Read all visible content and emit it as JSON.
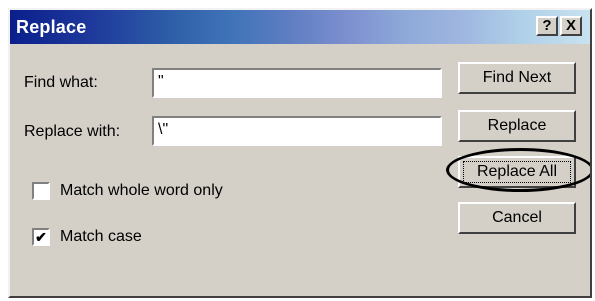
{
  "dialog": {
    "title": "Replace",
    "help_button": "?",
    "close_button": "X",
    "find_what_label": "Find what:",
    "find_what_value": "\"",
    "replace_with_label": "Replace with:",
    "replace_with_value": "\\\"",
    "match_whole_word_label": "Match whole word only",
    "match_whole_word_checked": false,
    "match_case_label": "Match case",
    "match_case_checked": true,
    "buttons": {
      "find_next": "Find Next",
      "replace": "Replace",
      "replace_all": "Replace All",
      "cancel": "Cancel"
    }
  }
}
